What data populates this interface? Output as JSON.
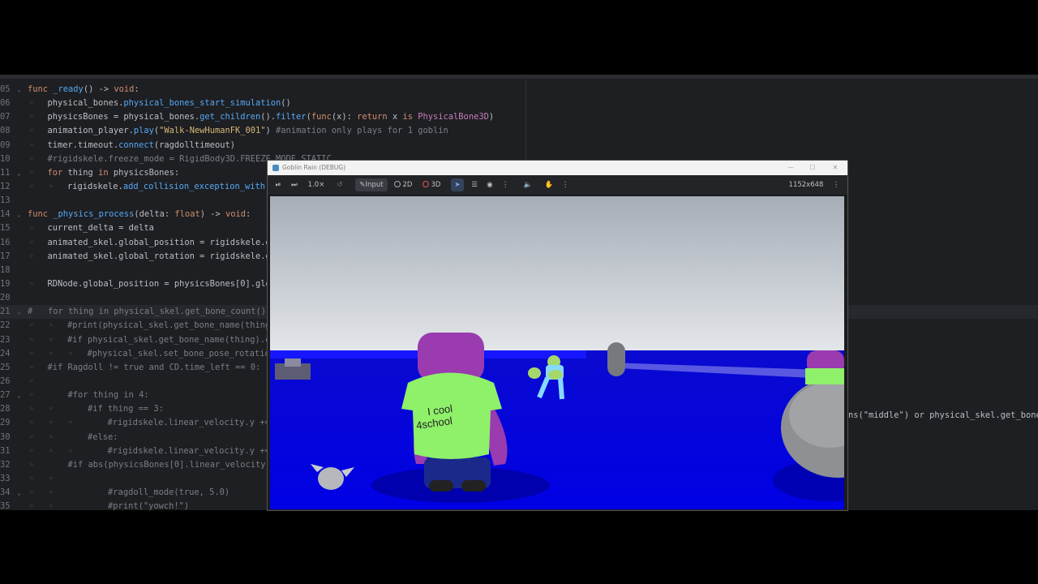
{
  "editor": {
    "lines": [
      {
        "n": "05",
        "fold": true,
        "parts": [
          [
            "kw",
            "func "
          ],
          [
            "fn",
            "_ready"
          ],
          [
            "",
            "() -> "
          ],
          [
            "kw",
            "void"
          ],
          [
            "",
            ":"
          ]
        ]
      },
      {
        "n": "06",
        "indent": 1,
        "parts": [
          [
            "",
            "physical_bones."
          ],
          [
            "fn",
            "physical_bones_start_simulation"
          ],
          [
            "",
            "()"
          ]
        ]
      },
      {
        "n": "07",
        "indent": 1,
        "parts": [
          [
            "",
            "physicsBones = physical_bones."
          ],
          [
            "fn",
            "get_children"
          ],
          [
            "",
            "()."
          ],
          [
            "fn",
            "filter"
          ],
          [
            "",
            "("
          ],
          [
            "kw",
            "func"
          ],
          [
            "",
            "(x): "
          ],
          [
            "kw",
            "return"
          ],
          [
            "",
            " x "
          ],
          [
            "kw",
            "is"
          ],
          [
            "",
            ""
          ],
          [
            "typ",
            " PhysicalBone3D"
          ],
          [
            "",
            ")"
          ]
        ]
      },
      {
        "n": "08",
        "indent": 1,
        "parts": [
          [
            "",
            "animation_player."
          ],
          [
            "fn",
            "play"
          ],
          [
            "",
            "("
          ],
          [
            "str",
            "\"Walk-NewHumanFK_001\""
          ],
          [
            "",
            ") "
          ],
          [
            "cmt",
            "#animation only plays for 1 goblin"
          ]
        ]
      },
      {
        "n": "09",
        "indent": 1,
        "parts": [
          [
            "",
            "timer.timeout."
          ],
          [
            "fn",
            "connect"
          ],
          [
            "",
            "(ragdolltimeout)"
          ]
        ]
      },
      {
        "n": "10",
        "indent": 1,
        "parts": [
          [
            "cmt",
            "#rigidskele.freeze_mode = RigidBody3D.FREEZE_MODE_STATIC"
          ]
        ]
      },
      {
        "n": "11",
        "indent": 1,
        "fold": true,
        "parts": [
          [
            "kw",
            "for"
          ],
          [
            "",
            " thing "
          ],
          [
            "kw",
            "in"
          ],
          [
            "",
            " physicsBones:"
          ]
        ]
      },
      {
        "n": "12",
        "indent": 2,
        "parts": [
          [
            "",
            "rigidskele."
          ],
          [
            "fn",
            "add_collision_exception_with"
          ],
          [
            "",
            "("
          ]
        ]
      },
      {
        "n": "13",
        "parts": []
      },
      {
        "n": "14",
        "fold": true,
        "parts": [
          [
            "kw",
            "func "
          ],
          [
            "fn",
            "_physics_process"
          ],
          [
            "",
            "(delta: "
          ],
          [
            "kw",
            "float"
          ],
          [
            "",
            ") -> "
          ],
          [
            "kw",
            "void"
          ],
          [
            "",
            ":"
          ]
        ]
      },
      {
        "n": "15",
        "indent": 1,
        "parts": [
          [
            "",
            "current_delta = delta"
          ]
        ]
      },
      {
        "n": "16",
        "indent": 1,
        "parts": [
          [
            "",
            "animated_skel.global_position = rigidskele.g"
          ]
        ]
      },
      {
        "n": "17",
        "indent": 1,
        "parts": [
          [
            "",
            "animated_skel.global_rotation = rigidskele.g"
          ]
        ]
      },
      {
        "n": "18",
        "parts": []
      },
      {
        "n": "19",
        "indent": 1,
        "parts": [
          [
            "",
            "RDNode.global_position = physicsBones[0].glo"
          ]
        ]
      },
      {
        "n": "20",
        "parts": []
      },
      {
        "n": "21",
        "fold": true,
        "hl": true,
        "parts": [
          [
            "cmt",
            "#"
          ],
          [
            "",
            "   "
          ],
          [
            "cmt",
            "for thing in physical_skel.get_bone_count():"
          ]
        ]
      },
      {
        "n": "22",
        "indent": 2,
        "parts": [
          [
            "cmt",
            "#print(physical_skel.get_bone_name(thing"
          ]
        ]
      },
      {
        "n": "23",
        "indent": 2,
        "parts": [
          [
            "cmt",
            "#if physical_skel.get_bone_name(thing).c"
          ]
        ]
      },
      {
        "n": "24",
        "indent": 3,
        "parts": [
          [
            "cmt",
            "#physical_skel.set_bone_pose_rotatio"
          ]
        ]
      },
      {
        "n": "25",
        "indent": 1,
        "parts": [
          [
            "cmt",
            "#if Ragdoll != true and CD.time_left == 0:"
          ]
        ]
      },
      {
        "n": "26",
        "indent": 1,
        "parts": []
      },
      {
        "n": "27",
        "indent": 1,
        "fold": true,
        "parts": [
          [
            "",
            "    "
          ],
          [
            "cmt",
            "#for thing in 4:"
          ]
        ]
      },
      {
        "n": "28",
        "indent": 2,
        "parts": [
          [
            "",
            "    "
          ],
          [
            "cmt",
            "#if thing == 3:"
          ]
        ]
      },
      {
        "n": "29",
        "indent": 3,
        "parts": [
          [
            "",
            "    "
          ],
          [
            "cmt",
            "#rigidskele.linear_velocity.y +="
          ]
        ]
      },
      {
        "n": "30",
        "indent": 2,
        "parts": [
          [
            "",
            "    "
          ],
          [
            "cmt",
            "#else:"
          ]
        ]
      },
      {
        "n": "31",
        "indent": 3,
        "parts": [
          [
            "",
            "    "
          ],
          [
            "cmt",
            "#rigidskele.linear_velocity.y +="
          ]
        ]
      },
      {
        "n": "32",
        "indent": 1,
        "parts": [
          [
            "",
            "    "
          ],
          [
            "cmt",
            "#if abs(physicsBones[0].linear_velocity)"
          ]
        ]
      },
      {
        "n": "33",
        "indent": 2,
        "parts": []
      },
      {
        "n": "34",
        "indent": 2,
        "fold": true,
        "parts": [
          [
            "",
            "        "
          ],
          [
            "cmt",
            "#ragdoll_mode(true, 5.0)"
          ]
        ]
      },
      {
        "n": "35",
        "indent": 2,
        "parts": [
          [
            "",
            "        "
          ],
          [
            "cmt",
            "#print(\"yowch!\")"
          ]
        ]
      }
    ],
    "overflow_right": "ns(\"middle\") or physical_skel.get_bone"
  },
  "game_window": {
    "title": "Goblin Rain (DEBUG)",
    "minimize": "—",
    "maximize": "☐",
    "close": "✕",
    "toolbar": {
      "speed": "1.0×",
      "input_label": "Input",
      "mode_2d": "2D",
      "mode_3d": "3D",
      "resolution": "1152x648"
    },
    "shirt_text_line1": "I cool",
    "shirt_text_line2": "4school"
  },
  "colors": {
    "floor": "#0000dd",
    "sky_top": "#a6adb7",
    "sky_bottom": "#e6e9ec",
    "goblin_purple": "#9a3bb0",
    "shirt_green": "#8ff06a"
  }
}
